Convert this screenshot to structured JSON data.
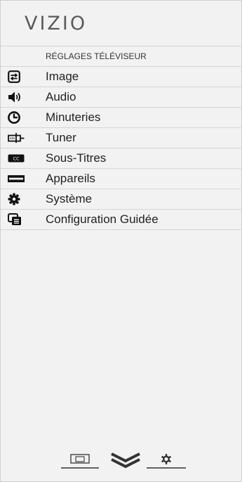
{
  "brand": {
    "logo_text": "VIZIO"
  },
  "menu": {
    "header": "RÉGLAGES TÉLÉVISEUR",
    "items": [
      {
        "label": "Image",
        "icon": "picture-icon"
      },
      {
        "label": "Audio",
        "icon": "speaker-icon"
      },
      {
        "label": "Minuteries",
        "icon": "timer-icon"
      },
      {
        "label": "Tuner",
        "icon": "tuner-icon"
      },
      {
        "label": "Sous-Titres",
        "icon": "closed-captions-icon"
      },
      {
        "label": "Appareils",
        "icon": "devices-icon"
      },
      {
        "label": "Système",
        "icon": "gear-icon"
      },
      {
        "label": "Configuration Guidée",
        "icon": "guided-setup-icon"
      }
    ]
  },
  "bottom_bar": {
    "icons": [
      "input-icon",
      "chevron-down-icon",
      "settings-icon"
    ]
  },
  "colors": {
    "panel_bg": "#f2f2f2",
    "divider": "#d5d5d5",
    "text": "#1e1e1e",
    "logo": "#5a5a5a"
  }
}
